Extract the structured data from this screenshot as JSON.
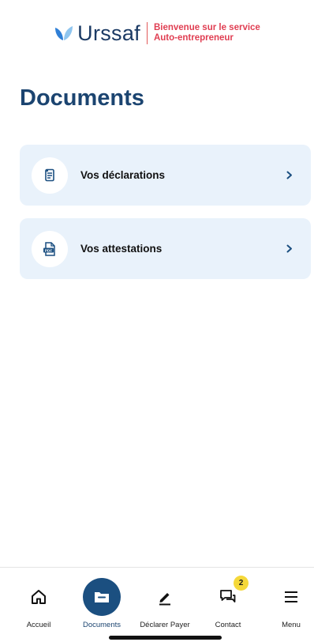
{
  "header": {
    "brand": "Urssaf",
    "tagline_line1": "Bienvenue sur le service",
    "tagline_line2": "Auto-entrepreneur",
    "logo_icon": "urssaf-leaf-icon"
  },
  "page": {
    "title": "Documents"
  },
  "cards": [
    {
      "label": "Vos déclarations",
      "icon": "declaration-document-icon"
    },
    {
      "label": "Vos attestations",
      "icon": "pdf-file-icon"
    }
  ],
  "bottom_nav": {
    "items": [
      {
        "label": "Accueil",
        "icon": "home-icon",
        "active": false
      },
      {
        "label": "Documents",
        "icon": "folder-icon",
        "active": true
      },
      {
        "label": "Déclarer Payer",
        "icon": "pen-icon",
        "active": false
      },
      {
        "label": "Contact",
        "icon": "chat-icon",
        "active": false,
        "badge": "2"
      },
      {
        "label": "Menu",
        "icon": "hamburger-menu-icon",
        "active": false
      }
    ]
  },
  "colors": {
    "brand_navy": "#1b4470",
    "accent_red": "#e03e52",
    "card_background": "#e9f2fb",
    "active_nav": "#1b4f80",
    "badge_yellow": "#f5d83a"
  }
}
